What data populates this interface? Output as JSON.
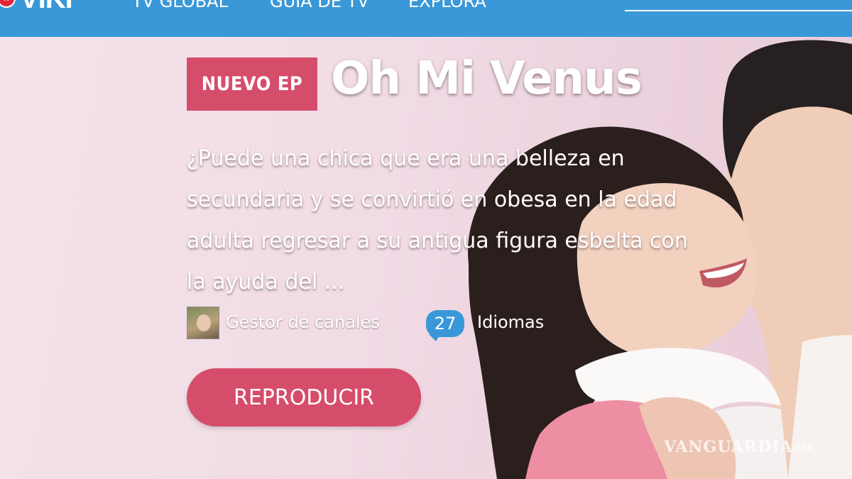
{
  "topbar": {
    "logo_badge": "R",
    "logo_text": "VIKI",
    "nav": [
      "TV GLOBAL",
      "GUÍA DE TV",
      "EXPLORA"
    ],
    "color": "#3a98d8"
  },
  "hero": {
    "badge": "NUEVO EP",
    "title": "Oh Mi Venus",
    "description": "¿Puede una chica que era una belleza en secundaria y se convirtió en obesa en la edad adulta regresar a su antigua figura esbelta con la ayuda del ...",
    "channel": "Gestor de canales",
    "languages_count": "27",
    "languages_label": "Idiomas",
    "play_button": "REPRODUCIR",
    "accent_color": "#d64d6b"
  },
  "watermark": {
    "text": "VANGUARDIA",
    "suffix": "MX"
  }
}
